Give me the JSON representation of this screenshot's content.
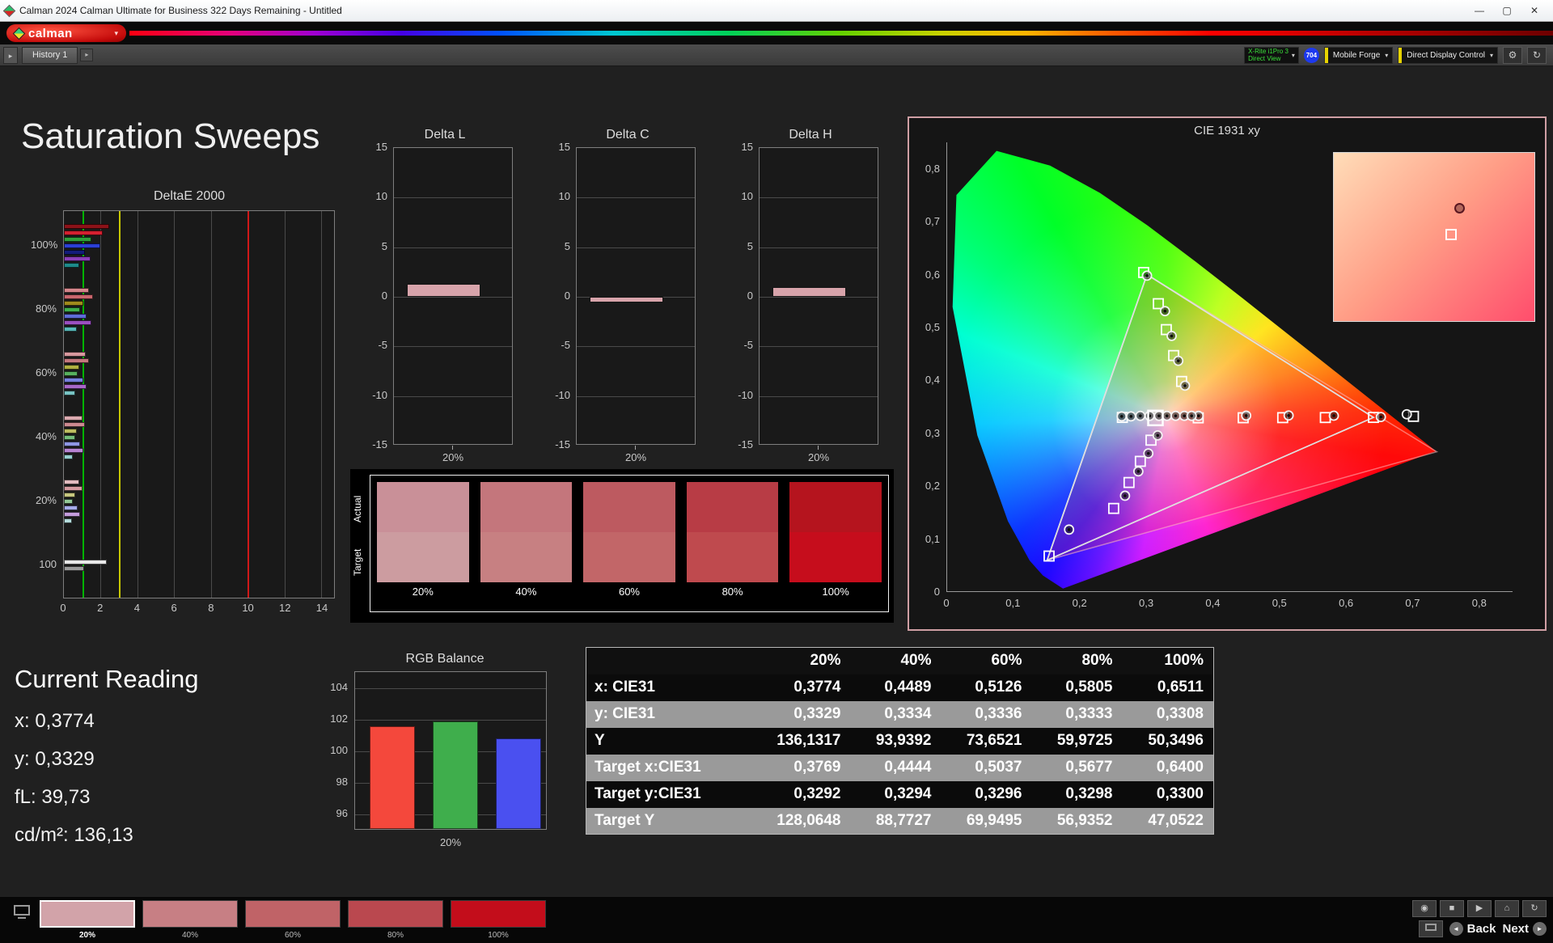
{
  "window": {
    "title": "Calman 2024 Calman Ultimate for Business 322 Days Remaining - Untitled"
  },
  "icons": {
    "minimize": "—",
    "maximize": "▢",
    "close": "✕",
    "dropdown": "▾",
    "gear": "⚙",
    "panel_toggle": "▸",
    "camera": "◉",
    "stop": "■",
    "play": "▶",
    "home": "⌂",
    "refresh": "↻",
    "back_circle": "◄",
    "next_circle": "►"
  },
  "brand": {
    "logo_text": "calman"
  },
  "toolbar": {
    "history_tab": "History 1",
    "meter": {
      "line1": "X-Rite i1Pro 3",
      "line2": "Direct View",
      "badge": "704"
    },
    "source": "Mobile Forge",
    "display_control": "Direct Display Control"
  },
  "page": {
    "title": "Saturation Sweeps",
    "current_reading": {
      "heading": "Current Reading",
      "lines": [
        "x: 0,3774",
        "y: 0,3329",
        "fL: 39,73",
        "cd/m²: 136,13"
      ]
    }
  },
  "nav": {
    "back": "Back",
    "next": "Next"
  },
  "swatch_panel": {
    "row_labels": [
      "Actual",
      "Target"
    ],
    "labels": [
      "20%",
      "40%",
      "60%",
      "80%",
      "100%"
    ],
    "actual": [
      "#c99098",
      "#c4767c",
      "#bd5a60",
      "#b83c45",
      "#b5141e"
    ],
    "target": [
      "#cc9ca0",
      "#c78082",
      "#c26668",
      "#bf4a4e",
      "#c60d1c"
    ]
  },
  "bottom_swatches": {
    "labels": [
      "20%",
      "40%",
      "60%",
      "80%",
      "100%"
    ],
    "colors": [
      "#d2a3a9",
      "#c77f84",
      "#c06367",
      "#ba484f",
      "#c30d1b"
    ],
    "selected": 0
  },
  "chart_data": [
    {
      "id": "deltae2000",
      "type": "bar",
      "orientation": "horizontal",
      "title": "DeltaE 2000",
      "xticks": [
        0,
        2,
        4,
        6,
        8,
        10,
        12,
        14
      ],
      "xlim": [
        0,
        14.7
      ],
      "reference_lines": [
        [
          1,
          "#00b400"
        ],
        [
          3,
          "#c8c800"
        ],
        [
          10,
          "#d01818"
        ]
      ],
      "groups": [
        {
          "label": "100%",
          "bars": [
            [
              "#8c1218",
              2.45
            ],
            [
              "#d42030",
              2.1
            ],
            [
              "#2f9e3a",
              1.5
            ],
            [
              "#2b3fd6",
              2.0
            ],
            [
              "#131c7a",
              1.15
            ],
            [
              "#8a3fb8",
              1.45
            ],
            [
              "#1d8a8a",
              0.85
            ]
          ]
        },
        {
          "label": "80%",
          "bars": [
            [
              "#d4858b",
              1.35
            ],
            [
              "#c9666d",
              1.6
            ],
            [
              "#a08a1c",
              1.05
            ],
            [
              "#3fae4c",
              0.9
            ],
            [
              "#5e6cd8",
              1.25
            ],
            [
              "#9a4fc0",
              1.5
            ],
            [
              "#58b8b8",
              0.7
            ]
          ]
        },
        {
          "label": "60%",
          "bars": [
            [
              "#d8989e",
              1.2
            ],
            [
              "#c4777d",
              1.35
            ],
            [
              "#b0b040",
              0.85
            ],
            [
              "#57b05e",
              0.75
            ],
            [
              "#7680de",
              1.05
            ],
            [
              "#a868c8",
              1.25
            ],
            [
              "#78c4c4",
              0.6
            ]
          ]
        },
        {
          "label": "40%",
          "bars": [
            [
              "#dcaab0",
              1.0
            ],
            [
              "#cc8990",
              1.15
            ],
            [
              "#bcbc60",
              0.7
            ],
            [
              "#74bc7a",
              0.6
            ],
            [
              "#8e96e4",
              0.9
            ],
            [
              "#b683d2",
              1.05
            ],
            [
              "#96d0d0",
              0.5
            ]
          ]
        },
        {
          "label": "20%",
          "bars": [
            [
              "#e2bcc0",
              0.85
            ],
            [
              "#d49aa0",
              1.0
            ],
            [
              "#c8c880",
              0.6
            ],
            [
              "#92c896",
              0.5
            ],
            [
              "#a6acea",
              0.75
            ],
            [
              "#c49cdc",
              0.9
            ],
            [
              "#b4dcdc",
              0.45
            ]
          ]
        },
        {
          "label": "100",
          "bars": [
            [
              "#e8e8e8",
              2.35
            ],
            [
              "#9a9a9a",
              1.1
            ]
          ]
        }
      ]
    },
    {
      "id": "deltaL",
      "type": "bar",
      "title": "Delta L",
      "categories": [
        "20%"
      ],
      "values": [
        1.3
      ],
      "ylim": [
        -15,
        15
      ],
      "yticks": [
        15,
        10,
        5,
        0,
        -5,
        -10,
        -15
      ],
      "bar_color": "#d8a4ab"
    },
    {
      "id": "deltaC",
      "type": "bar",
      "title": "Delta C",
      "categories": [
        "20%"
      ],
      "values": [
        -0.6
      ],
      "ylim": [
        -15,
        15
      ],
      "yticks": [
        15,
        10,
        5,
        0,
        -5,
        -10,
        -15
      ],
      "bar_color": "#d8a4ab"
    },
    {
      "id": "deltaH",
      "type": "bar",
      "title": "Delta H",
      "categories": [
        "20%"
      ],
      "values": [
        1.0
      ],
      "ylim": [
        -15,
        15
      ],
      "yticks": [
        15,
        10,
        5,
        0,
        -5,
        -10,
        -15
      ],
      "bar_color": "#d8a4ab"
    },
    {
      "id": "rgb_balance",
      "type": "bar",
      "title": "RGB Balance",
      "xlabel": "20%",
      "categories": [
        "Red",
        "Green",
        "Blue"
      ],
      "values": [
        101.5,
        101.8,
        100.7
      ],
      "colors": [
        "#f4483c",
        "#3fae4c",
        "#4a50f0"
      ],
      "ylim": [
        95,
        105
      ],
      "yticks": [
        104,
        102,
        100,
        98,
        96
      ]
    },
    {
      "id": "cie1931",
      "type": "scatter",
      "title": "CIE 1931 xy",
      "xlim": [
        0,
        0.85
      ],
      "ylim": [
        0,
        0.85
      ],
      "xtick_labels": [
        "0",
        "0,1",
        "0,2",
        "0,3",
        "0,4",
        "0,5",
        "0,6",
        "0,7",
        "0,8"
      ],
      "ytick_labels": [
        "0",
        "0,1",
        "0,2",
        "0,3",
        "0,4",
        "0,5",
        "0,6",
        "0,7",
        "0,8"
      ],
      "gamut_triangle": [
        [
          0.64,
          0.33
        ],
        [
          0.3,
          0.6
        ],
        [
          0.15,
          0.06
        ]
      ],
      "native_triangle": [
        [
          0.735,
          0.265
        ],
        [
          0.3,
          0.6
        ],
        [
          0.15,
          0.06
        ]
      ],
      "white_point": [
        0.3127,
        0.329
      ],
      "measured": [
        [
          0.3774,
          0.333
        ],
        [
          0.4489,
          0.3334
        ],
        [
          0.5126,
          0.3336
        ],
        [
          0.5805,
          0.3333
        ],
        [
          0.6511,
          0.3308
        ],
        [
          0.318,
          0.333
        ],
        [
          0.33,
          0.333
        ],
        [
          0.343,
          0.333
        ],
        [
          0.356,
          0.333
        ],
        [
          0.367,
          0.333
        ],
        [
          0.262,
          0.332
        ],
        [
          0.276,
          0.332
        ],
        [
          0.29,
          0.333
        ],
        [
          0.304,
          0.333
        ],
        [
          0.357,
          0.39
        ],
        [
          0.347,
          0.437
        ],
        [
          0.337,
          0.484
        ],
        [
          0.327,
          0.531
        ],
        [
          0.3,
          0.598
        ],
        [
          0.316,
          0.296
        ],
        [
          0.302,
          0.262
        ],
        [
          0.287,
          0.228
        ],
        [
          0.267,
          0.182
        ],
        [
          0.183,
          0.118
        ],
        [
          0.69,
          0.336
        ]
      ],
      "targets": [
        [
          0.3769,
          0.3292
        ],
        [
          0.4444,
          0.3294
        ],
        [
          0.5037,
          0.3296
        ],
        [
          0.5677,
          0.3298
        ],
        [
          0.64,
          0.33
        ],
        [
          0.7,
          0.332
        ],
        [
          0.263,
          0.33
        ],
        [
          0.352,
          0.398
        ],
        [
          0.34,
          0.447
        ],
        [
          0.329,
          0.496
        ],
        [
          0.317,
          0.545
        ],
        [
          0.295,
          0.604
        ],
        [
          0.306,
          0.287
        ],
        [
          0.29,
          0.247
        ],
        [
          0.273,
          0.207
        ],
        [
          0.25,
          0.158
        ],
        [
          0.153,
          0.068
        ]
      ]
    },
    {
      "id": "measurement_table",
      "type": "table",
      "columns": [
        "",
        "20%",
        "40%",
        "60%",
        "80%",
        "100%"
      ],
      "rows": [
        [
          "x: CIE31",
          "0,3774",
          "0,4489",
          "0,5126",
          "0,5805",
          "0,6511"
        ],
        [
          "y: CIE31",
          "0,3329",
          "0,3334",
          "0,3336",
          "0,3333",
          "0,3308"
        ],
        [
          "Y",
          "136,1317",
          "93,9392",
          "73,6521",
          "59,9725",
          "50,3496"
        ],
        [
          "Target x:CIE31",
          "0,3769",
          "0,4444",
          "0,5037",
          "0,5677",
          "0,6400"
        ],
        [
          "Target y:CIE31",
          "0,3292",
          "0,3294",
          "0,3296",
          "0,3298",
          "0,3300"
        ],
        [
          "Target Y",
          "128,0648",
          "88,7727",
          "69,9495",
          "56,9352",
          "47,0522"
        ]
      ]
    }
  ]
}
